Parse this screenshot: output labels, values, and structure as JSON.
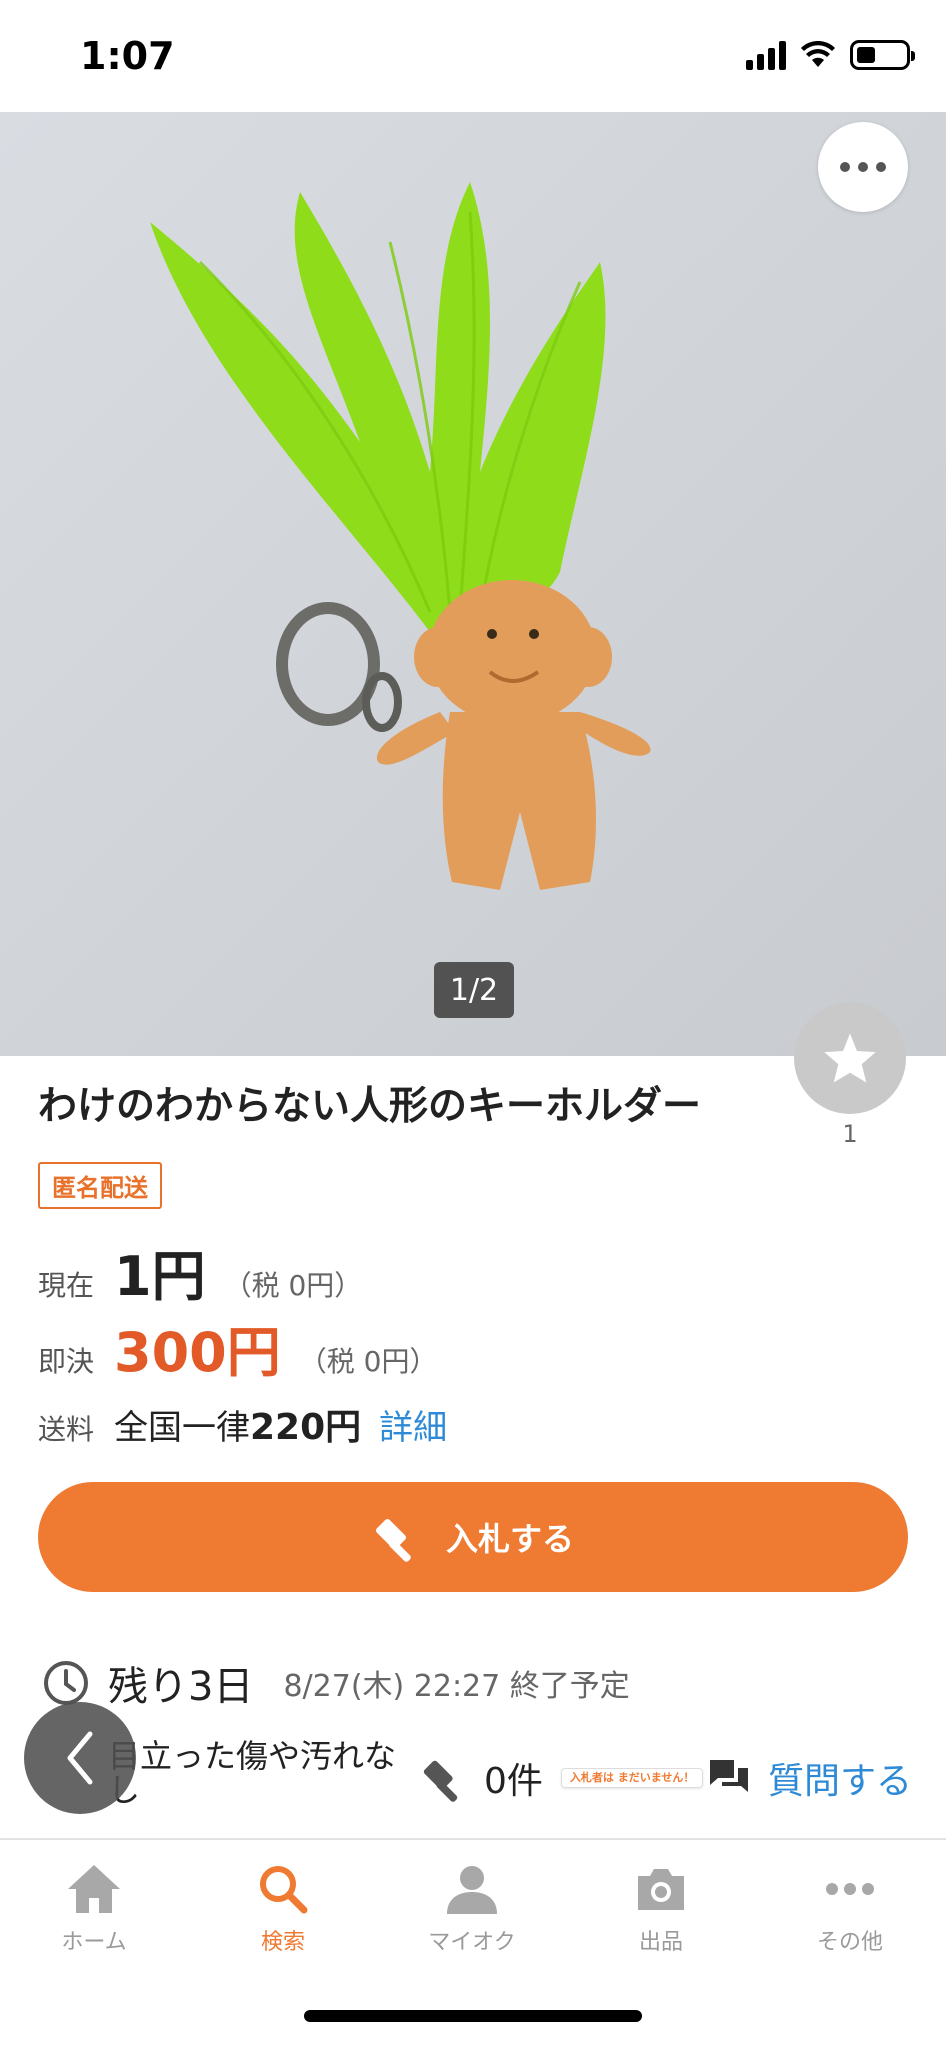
{
  "status_bar": {
    "time": "1:07"
  },
  "listing": {
    "image_index": "1/2",
    "watch_count": "1",
    "title": "わけのわからない人形のキーホルダー",
    "badge": "匿名配送",
    "current": {
      "label": "現在",
      "price": "1円",
      "tax": "（税 0円）"
    },
    "buyout": {
      "label": "即決",
      "price": "300円",
      "tax": "（税 0円）"
    },
    "shipping": {
      "label": "送料",
      "text": "全国一律",
      "amount": "220円",
      "link": "詳細"
    },
    "bid_button_label": "入札する",
    "remaining": {
      "label": "残り3日",
      "end_time": "8/27(木) 22:27 終了予定"
    },
    "condition": "目立った傷や汚れなし",
    "bid_count": "0件",
    "no_bids_badge": "入札者は まだいません！",
    "question_label": "質問する"
  },
  "tabs": [
    {
      "label": "ホーム",
      "icon": "home-icon",
      "active": false
    },
    {
      "label": "検索",
      "icon": "search-icon",
      "active": true
    },
    {
      "label": "マイオク",
      "icon": "person-icon",
      "active": false
    },
    {
      "label": "出品",
      "icon": "camera-icon",
      "active": false
    },
    {
      "label": "その他",
      "icon": "more-icon",
      "active": false
    }
  ],
  "colors": {
    "accent": "#ef7a32",
    "buyout": "#e25a27",
    "link": "#2e8ad6"
  }
}
